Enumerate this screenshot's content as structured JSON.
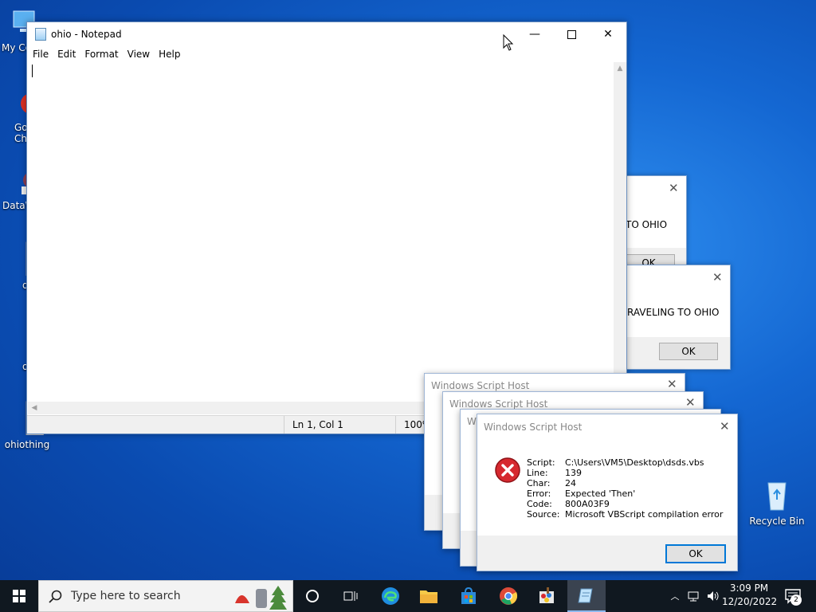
{
  "desktop": {
    "icons": [
      {
        "label": "My Co",
        "icon": "computer-icon"
      },
      {
        "label": "Go",
        "label2": "Ch",
        "icon": "chrome-icon"
      },
      {
        "label": "DataW",
        "icon": "datawrapper-icon"
      },
      {
        "label": "d",
        "icon": "script-file-icon"
      },
      {
        "label": "o",
        "icon": "text-file-icon"
      },
      {
        "label": "ohiothing",
        "icon": "script-file-icon"
      },
      {
        "label": "Recycle Bin",
        "icon": "recycle-bin-icon"
      }
    ]
  },
  "notepad": {
    "title": "ohio - Notepad",
    "menu": [
      "File",
      "Edit",
      "Format",
      "View",
      "Help"
    ],
    "content": "",
    "status": {
      "position": "Ln 1, Col 1",
      "zoom": "100%"
    }
  },
  "message_boxes": [
    {
      "text": "TO OHIO",
      "ok": "OK"
    },
    {
      "text": "RAVELING TO OHIO",
      "ok": "OK"
    }
  ],
  "wsh_dialogs": {
    "caption": "Windows Script Host",
    "partial_caption": "W",
    "error": {
      "labels": [
        "Script:",
        "Line:",
        "Char:",
        "Error:",
        "Code:",
        "Source:"
      ],
      "values": [
        "C:\\Users\\VM5\\Desktop\\dsds.vbs",
        "139",
        "24",
        "Expected 'Then'",
        "800A03F9",
        "Microsoft VBScript compilation error"
      ]
    },
    "ok": "OK"
  },
  "taskbar": {
    "search_placeholder": "Type here to search",
    "apps": [
      "task-view-icon",
      "edge-icon",
      "file-explorer-icon",
      "store-icon",
      "chrome-icon",
      "paint-icon",
      "notepad-icon"
    ],
    "clock": {
      "time": "3:09 PM",
      "date": "12/20/2022"
    },
    "notification_count": "2"
  },
  "colors": {
    "accent": "#0078d7",
    "error_red": "#d6292f",
    "taskbar": "#101820"
  }
}
